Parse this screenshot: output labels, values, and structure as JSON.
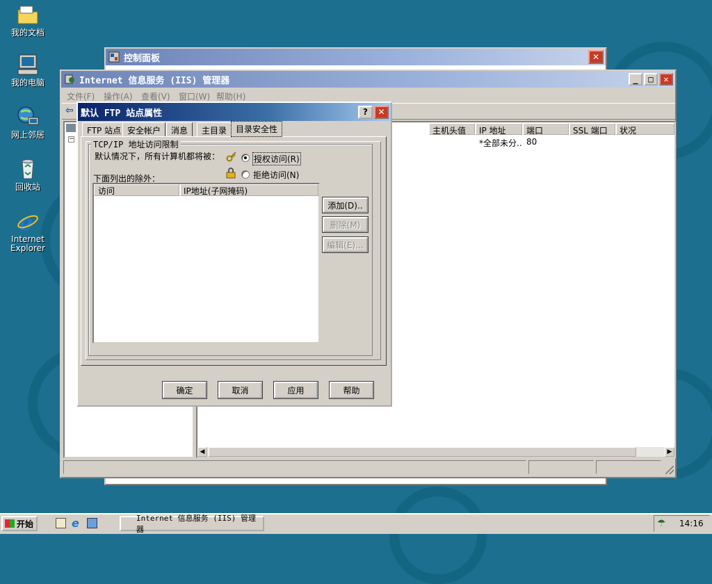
{
  "desktop": {
    "icons": [
      {
        "label": "我的文档",
        "icon": "folder-icon"
      },
      {
        "label": "我的电脑",
        "icon": "computer-icon"
      },
      {
        "label": "网上邻居",
        "icon": "network-icon"
      },
      {
        "label": "回收站",
        "icon": "recycle-bin-icon"
      },
      {
        "label": "Internet Explorer",
        "icon": "ie-icon"
      }
    ]
  },
  "control_panel": {
    "title": "控制面板"
  },
  "iis": {
    "title": "Internet 信息服务 (IIS) 管理器",
    "menu": [
      "文件(F)",
      "操作(A)",
      "查看(V)",
      "窗口(W)",
      "帮助(H)"
    ],
    "columns": [
      "主机头值",
      "IP 地址",
      "端口",
      "SSL 端口",
      "状况"
    ],
    "row": {
      "ip": "*全部未分..",
      "port": "80"
    }
  },
  "dialog": {
    "title": "默认 FTP 站点属性",
    "tabs": [
      "FTP 站点",
      "安全帐户",
      "消息",
      "主目录",
      "目录安全性"
    ],
    "active_tab": "目录安全性",
    "group_title": "TCP/IP 地址访问限制",
    "default_text": "默认情况下，所有计算机都将被：",
    "grant_label": "授权访问(R)",
    "deny_label": "拒绝访问(N)",
    "selected": "grant",
    "except_label": "下面列出的除外：",
    "list_columns": [
      "访问",
      "IP地址(子网掩码)"
    ],
    "side_buttons": {
      "add": "添加(D)..",
      "remove": "删除(M)",
      "edit": "编辑(E)..."
    },
    "bottom_buttons": {
      "ok": "确定",
      "cancel": "取消",
      "apply": "应用",
      "help": "帮助"
    }
  },
  "taskbar": {
    "start": "开始",
    "task": "Internet 信息服务 (IIS) 管理器",
    "time": "14:16"
  },
  "colors": {
    "desktop": "#1c6f8f",
    "title_active": "#0a246a",
    "close": "#c83a26"
  }
}
